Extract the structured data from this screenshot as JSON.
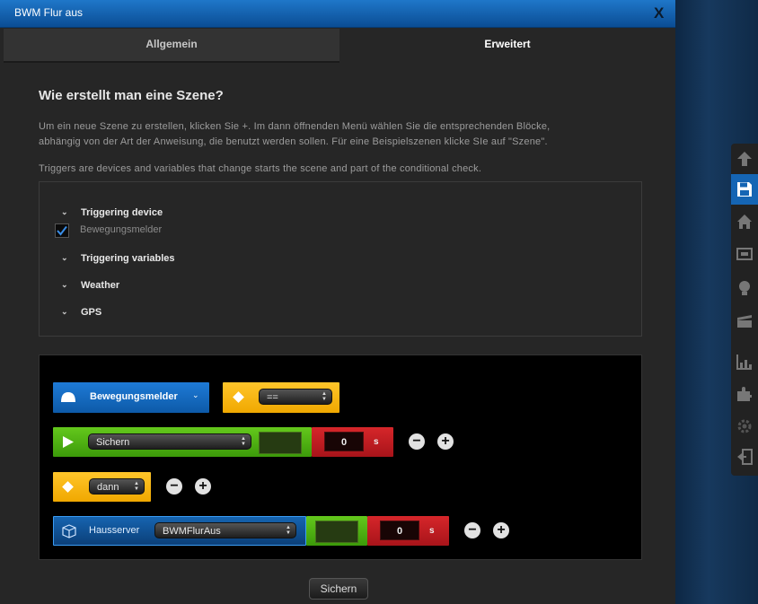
{
  "window": {
    "title": "BWM Flur aus",
    "close_label": "X"
  },
  "tabs": [
    {
      "label": "Allgemein",
      "active": false
    },
    {
      "label": "Erweitert",
      "active": true
    }
  ],
  "heading": "Wie erstellt man eine Szene?",
  "intro_line1": "Um ein neue Szene zu erstellen, klicken Sie +. Im dann öffnenden Menü wählen Sie die entsprechenden Blöcke,",
  "intro_line2": "abhängig von der Art der Anweisung, die benutzt werden sollen. Für eine Beispielszenen klicke SIe auf \"Szene\".",
  "triggers_text": "Triggers are devices and variables that change starts the scene and part of the conditional check.",
  "triggers": {
    "device_label": "Triggering device",
    "device_checked": {
      "label": "Bewegungsmelder",
      "checked": true
    },
    "variables_label": "Triggering variables",
    "weather_label": "Weather",
    "gps_label": "GPS"
  },
  "scene": {
    "row1": {
      "device_label": "Bewegungsmelder",
      "operator": "=="
    },
    "row2": {
      "select": "Sichern",
      "delay_value": "0",
      "delay_unit": "s"
    },
    "row3": {
      "select": "dann"
    },
    "row4": {
      "label": "Hausserver",
      "select": "BWMFlurAus",
      "delay_value": "0",
      "delay_unit": "s"
    },
    "minus_label": "−",
    "plus_label": "+"
  },
  "save_button": "Sichern",
  "toolbar_icons": [
    "arrow-up-icon",
    "save-icon",
    "home-icon",
    "devices-icon",
    "bulb-icon",
    "scene-clapper-icon",
    "chart-icon",
    "puzzle-icon",
    "settings-icon",
    "logout-icon"
  ],
  "colors": {
    "accent_blue": "#1565b4",
    "block_yellow": "#f0a800",
    "block_green": "#4caf14",
    "block_red": "#c41e22"
  }
}
